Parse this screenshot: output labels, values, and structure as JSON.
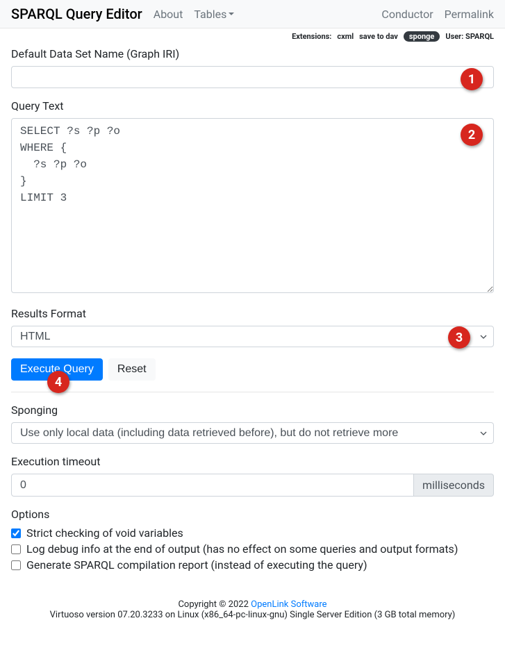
{
  "navbar": {
    "brand": "SPARQL Query Editor",
    "about": "About",
    "tables": "Tables",
    "conductor": "Conductor",
    "permalink": "Permalink"
  },
  "extensions": {
    "label": "Extensions:",
    "cxml": "cxml",
    "save_to_dav": "save to dav",
    "sponge": "sponge",
    "user_label": "User:",
    "user_value": "SPARQL"
  },
  "form": {
    "graph_iri_label": "Default Data Set Name (Graph IRI)",
    "graph_iri_value": "",
    "query_label": "Query Text",
    "query_value": "SELECT ?s ?p ?o\nWHERE {\n  ?s ?p ?o\n}\nLIMIT 3",
    "results_format_label": "Results Format",
    "results_format_value": "HTML",
    "execute_label": "Execute Query",
    "reset_label": "Reset",
    "sponging_label": "Sponging",
    "sponging_value": "Use only local data (including data retrieved before), but do not retrieve more",
    "timeout_label": "Execution timeout",
    "timeout_value": "0",
    "timeout_unit": "milliseconds",
    "options_label": "Options",
    "opt_strict_label": "Strict checking of void variables",
    "opt_strict_checked": true,
    "opt_debug_label": "Log debug info at the end of output (has no effect on some queries and output formats)",
    "opt_debug_checked": false,
    "opt_report_label": "Generate SPARQL compilation report (instead of executing the query)",
    "opt_report_checked": false
  },
  "footer": {
    "copyright_prefix": "Copyright © 2022 ",
    "openlink": "OpenLink Software",
    "version": "Virtuoso version 07.20.3233 on Linux (x86_64-pc-linux-gnu) Single Server Edition (3 GB total memory)"
  },
  "markers": {
    "m1": "1",
    "m2": "2",
    "m3": "3",
    "m4": "4"
  }
}
